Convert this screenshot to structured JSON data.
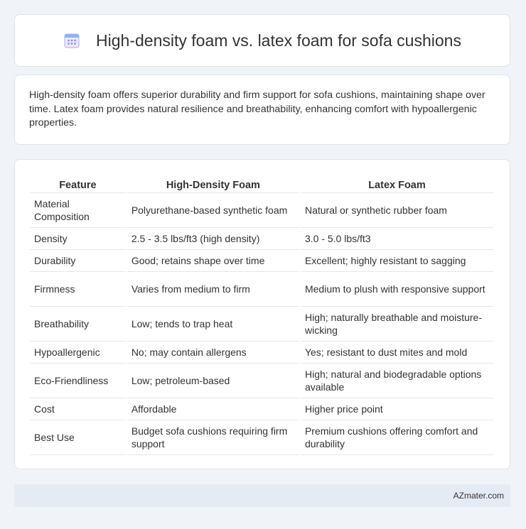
{
  "header": {
    "title": "High-density foam vs. latex foam for sofa cushions",
    "icon": "calendar-icon"
  },
  "summary": {
    "text": "High-density foam offers superior durability and firm support for sofa cushions, maintaining shape over time. Latex foam provides natural resilience and breathability, enhancing comfort with hypoallergenic properties."
  },
  "table": {
    "headers": [
      "Feature",
      "High-Density Foam",
      "Latex Foam"
    ],
    "rows": [
      [
        "Material Composition",
        "Polyurethane-based synthetic foam",
        "Natural or synthetic rubber foam"
      ],
      [
        "Density",
        "2.5 - 3.5 lbs/ft3 (high density)",
        "3.0 - 5.0 lbs/ft3"
      ],
      [
        "Durability",
        "Good; retains shape over time",
        "Excellent; highly resistant to sagging"
      ],
      [
        "Firmness",
        "Varies from medium to firm",
        "Medium to plush with responsive support"
      ],
      [
        "Breathability",
        "Low; tends to trap heat",
        "High; naturally breathable and moisture-wicking"
      ],
      [
        "Hypoallergenic",
        "No; may contain allergens",
        "Yes; resistant to dust mites and mold"
      ],
      [
        "Eco-Friendliness",
        "Low; petroleum-based",
        "High; natural and biodegradable options available"
      ],
      [
        "Cost",
        "Affordable",
        "Higher price point"
      ],
      [
        "Best Use",
        "Budget sofa cushions requiring firm support",
        "Premium cushions offering comfort and durability"
      ]
    ]
  },
  "footer": {
    "brand": "AZmater.com"
  },
  "colors": {
    "background": "#f0f3f8",
    "card": "#ffffff",
    "footer": "#e5ebf5",
    "icon_accent": "#8a7be0"
  }
}
